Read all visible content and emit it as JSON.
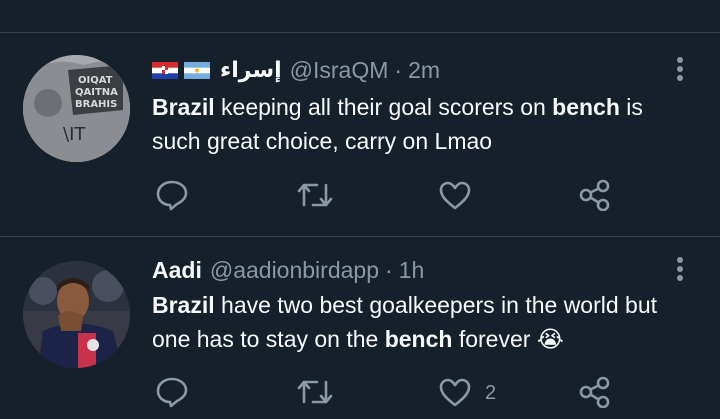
{
  "tweets": [
    {
      "flags": [
        "croatia-flag",
        "argentina-flag"
      ],
      "display_name": "إسراء",
      "handle": "@IsraQM",
      "separator": "·",
      "time": "2m",
      "text": {
        "p1": "Brazil",
        "p2": " keeping all their goal scorers on ",
        "p3": "bench",
        "p4": " is such great choice, carry on Lmao"
      },
      "actions": {
        "reply_icon": "reply-icon",
        "retweet_icon": "retweet-icon",
        "like_icon": "heart-icon",
        "share_icon": "share-icon",
        "like_count": ""
      }
    },
    {
      "display_name": "Aadi",
      "handle": "@aadionbirdapp",
      "separator": "·",
      "time": "1h",
      "text": {
        "p1": "Brazil",
        "p2": " have two best goalkeepers in the world but one has to stay on the ",
        "p3": "bench",
        "p4": " forever ",
        "emoji": "😭"
      },
      "actions": {
        "reply_icon": "reply-icon",
        "retweet_icon": "retweet-icon",
        "like_icon": "heart-icon",
        "share_icon": "share-icon",
        "like_count": "2"
      }
    }
  ],
  "colors": {
    "background": "#15202b",
    "text": "#f7f9f9",
    "muted": "#8b98a5",
    "divider": "#38444d"
  }
}
